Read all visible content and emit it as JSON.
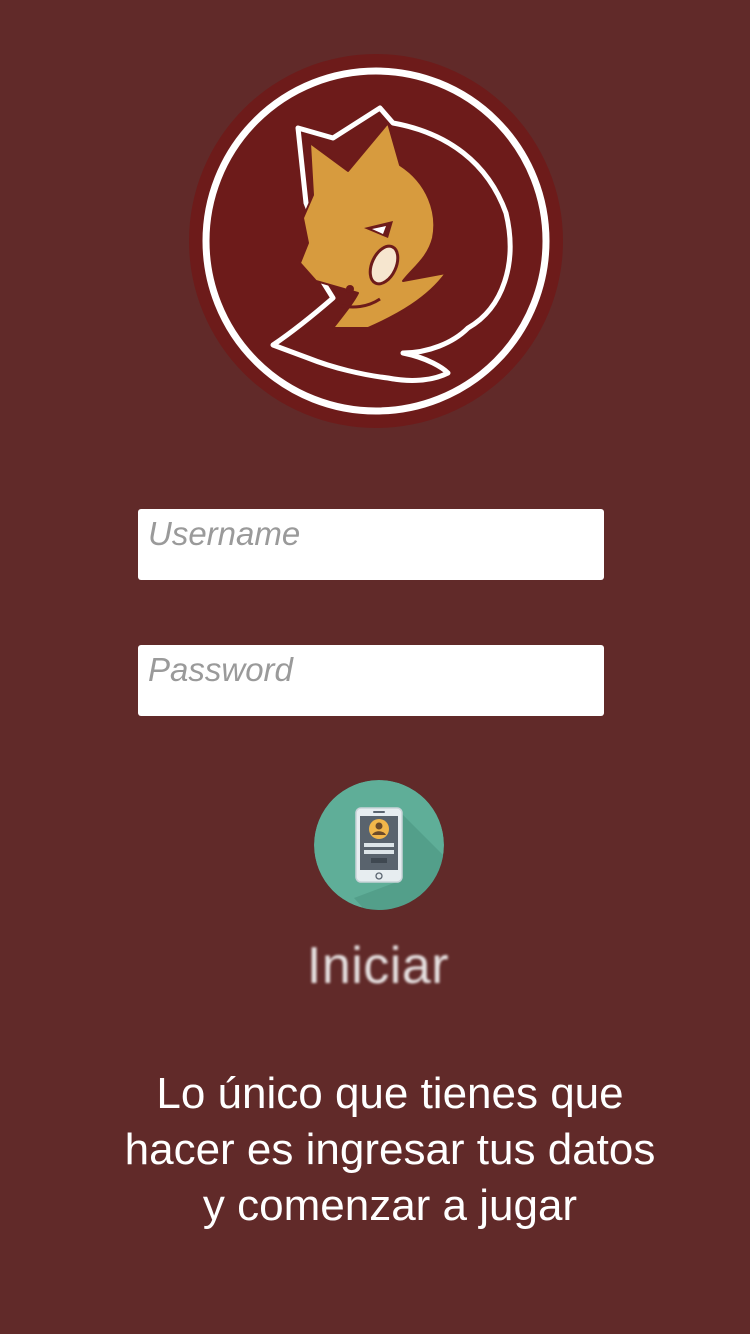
{
  "logo": {
    "icon": "horned-mascot-logo-icon"
  },
  "login": {
    "username_placeholder": "Username",
    "username_value": "",
    "password_placeholder": "Password",
    "password_value": ""
  },
  "start": {
    "icon": "smartphone-profile-icon",
    "label": "Iniciar"
  },
  "instructions": {
    "lines": [
      "Lo único que tienes que",
      "hacer es ingresar tus datos",
      "y comenzar a jugar"
    ]
  },
  "colors": {
    "background": "#612a29",
    "logo_circle": "#6d1b1a",
    "mascot": "#d79b3e",
    "button": "#5fae98"
  }
}
